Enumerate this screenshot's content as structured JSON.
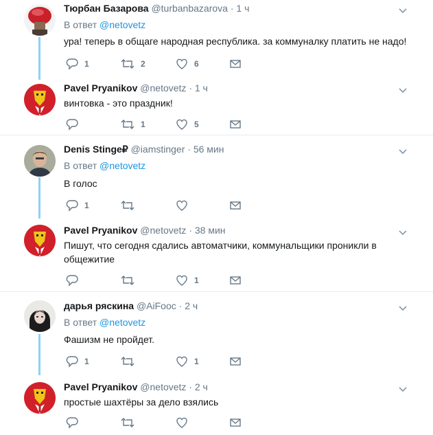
{
  "reply_prefix": "В ответ",
  "threads": [
    {
      "tweets": [
        {
          "name": "Тюрбан Базарова",
          "handle": "@turbanbazarova",
          "time": "· 1 ч",
          "reply_to": "@netovetz",
          "text": "ура! теперь в общаге народная республика. за коммуналку платить не надо!",
          "replies": "1",
          "retweets": "2",
          "likes": "6",
          "avatar": "turban-avatar"
        },
        {
          "name": "Pavel Pryanikov",
          "handle": "@netovetz",
          "time": "· 1 ч",
          "reply_to": "",
          "text": "винтовка - это праздник!",
          "replies": "",
          "retweets": "1",
          "likes": "5",
          "avatar": "red-mask-avatar"
        }
      ]
    },
    {
      "tweets": [
        {
          "name": "Denis Stinge₽",
          "handle": "@iamstinger",
          "time": "· 56 мин",
          "reply_to": "@netovetz",
          "text": "В голос",
          "replies": "1",
          "retweets": "",
          "likes": "",
          "avatar": "man-photo-avatar"
        },
        {
          "name": "Pavel Pryanikov",
          "handle": "@netovetz",
          "time": "· 38 мин",
          "reply_to": "",
          "text": "Пишут, что сегодня сдались автоматчики, коммунальщики проникли в общежитие",
          "replies": "",
          "retweets": "",
          "likes": "1",
          "avatar": "red-mask-avatar"
        }
      ]
    },
    {
      "tweets": [
        {
          "name": "дарья ряскина",
          "handle": "@AiFooc",
          "time": "· 2 ч",
          "reply_to": "@netovetz",
          "text": "Фашизм не пройдет.",
          "replies": "1",
          "retweets": "",
          "likes": "1",
          "avatar": "girl-photo-avatar"
        },
        {
          "name": "Pavel Pryanikov",
          "handle": "@netovetz",
          "time": "· 2 ч",
          "reply_to": "",
          "text": "простые шахтёры за дело взялись",
          "replies": "",
          "retweets": "",
          "likes": "",
          "avatar": "red-mask-avatar"
        }
      ]
    }
  ],
  "icons": {
    "reply": "reply-icon",
    "retweet": "retweet-icon",
    "like": "heart-icon",
    "dm": "envelope-icon",
    "caret": "chevron-down-icon"
  },
  "colors": {
    "link": "#1b95e0",
    "muted": "#657786",
    "connector": "#8ed0f9",
    "divider": "#e6ecf0"
  }
}
